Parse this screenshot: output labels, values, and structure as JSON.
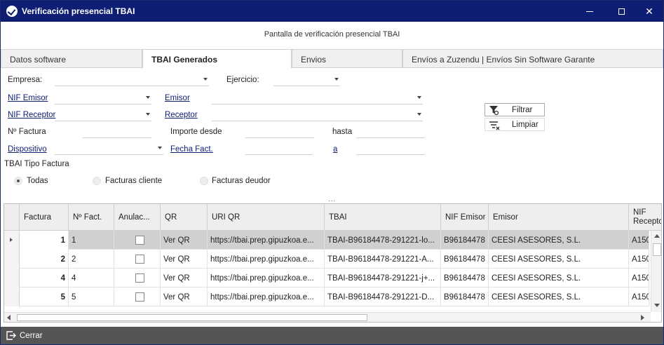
{
  "window": {
    "title": "Verificación presencial TBAI",
    "subtitle": "Pantalla de verificación presencial TBAI"
  },
  "tabs": [
    {
      "label": "Datos software"
    },
    {
      "label": "TBAI Generados"
    },
    {
      "label": "Envios"
    },
    {
      "label": "Envíos a Zuzendu | Envíos Sin Software Garante"
    }
  ],
  "active_tab": "TBAI Generados",
  "filters": {
    "empresa_label": "Empresa:",
    "ejercicio_label": "Ejercicio:",
    "nif_emisor_label": "NIF Emisor",
    "emisor_label": "Emisor",
    "nif_receptor_label": "NIF Receptor",
    "receptor_label": "Receptor",
    "num_factura_label": "Nº Factura",
    "importe_desde_label": "Importe desde",
    "hasta_label": "hasta",
    "dispositivo_label": "Dispositivo",
    "fecha_fact_label": "Fecha Fact.",
    "a_label": "a",
    "tipo_factura_label": "TBAI Tipo Factura",
    "radio_todas": "Todas",
    "radio_clientes": "Facturas cliente",
    "radio_deudor": "Facturas deudor",
    "selected_radio": "Todas"
  },
  "buttons": {
    "filtrar": "Filtrar",
    "limpiar": "Limpiar",
    "cerrar": "Cerrar"
  },
  "splitter": "...",
  "grid": {
    "columns": [
      "Factura",
      "Nº Fact.",
      "Anulac...",
      "QR",
      "URI QR",
      "TBAI",
      "NIF Emisor",
      "Emisor",
      "NIF Receptor"
    ],
    "rows": [
      {
        "factura": "1",
        "num": "1",
        "anulada": false,
        "qr": "Ver QR",
        "uri": "https://tbai.prep.gipuzkoa.e...",
        "tbai": "TBAI-B96184478-291221-lo...",
        "nif_emisor": "B96184478",
        "emisor": "CEESI ASESORES, S.L.",
        "nif_receptor": "A150"
      },
      {
        "factura": "2",
        "num": "2",
        "anulada": false,
        "qr": "Ver QR",
        "uri": "https://tbai.prep.gipuzkoa.e...",
        "tbai": "TBAI-B96184478-291221-A...",
        "nif_emisor": "B96184478",
        "emisor": "CEESI ASESORES, S.L.",
        "nif_receptor": "A150"
      },
      {
        "factura": "4",
        "num": "4",
        "anulada": false,
        "qr": "Ver QR",
        "uri": "https://tbai.prep.gipuzkoa.e...",
        "tbai": "TBAI-B96184478-291221-j+...",
        "nif_emisor": "B96184478",
        "emisor": "CEESI ASESORES, S.L.",
        "nif_receptor": "A150"
      },
      {
        "factura": "5",
        "num": "5",
        "anulada": false,
        "qr": "Ver QR",
        "uri": "https://tbai.prep.gipuzkoa.e...",
        "tbai": "TBAI-B96184478-291221-D...",
        "nif_emisor": "B96184478",
        "emisor": "CEESI ASESORES, S.L.",
        "nif_receptor": "A150"
      }
    ]
  },
  "colors": {
    "titlebar": "#0d1e73",
    "footer": "#555555",
    "selected_row": "#d0d0d0",
    "link": "#0d1e73"
  }
}
